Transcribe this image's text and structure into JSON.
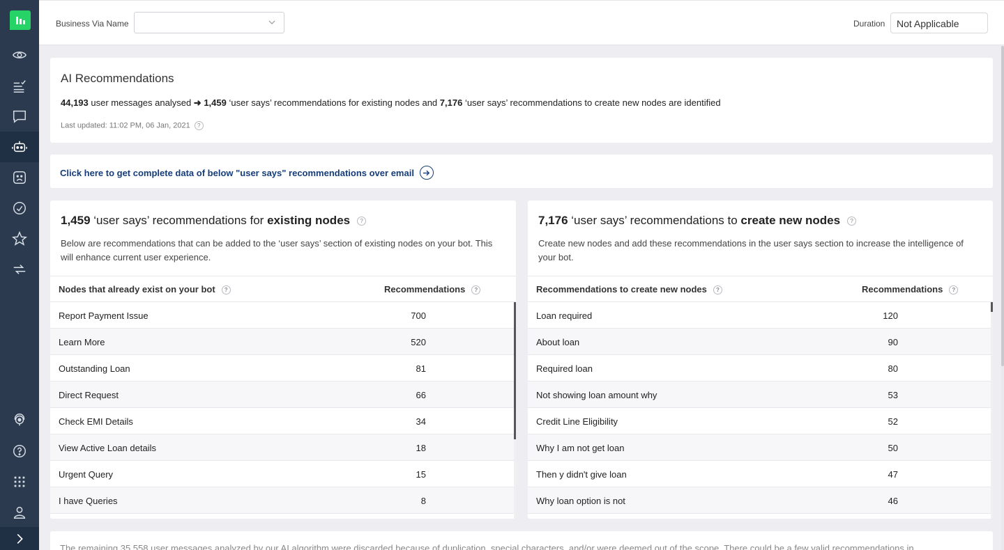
{
  "colors": {
    "sidebar": "#2b3a4e",
    "accent": "#25d366",
    "link": "#163d7a"
  },
  "sidebar": {
    "icons": [
      "app-logo-icon",
      "eye-icon",
      "checklist-icon",
      "chat-icon",
      "bot-icon",
      "sad-face-icon",
      "gauge-icon",
      "star-icon",
      "integration-icon",
      "support-icon",
      "help-icon",
      "apps-grid-icon",
      "user-icon",
      "expand-icon"
    ]
  },
  "topbar": {
    "business_label": "Business Via Name",
    "business_value": "",
    "duration_label": "Duration",
    "duration_value": "Not Applicable"
  },
  "ai": {
    "title": "AI Recommendations",
    "messages_count": "44,193",
    "messages_text": " user messages analysed ",
    "arrow": "➜",
    "existing_count": "1,459",
    "existing_text": " ‘user says’ recommendations for existing nodes and ",
    "new_count": "7,176",
    "new_text": " ‘user says’ recommendations to create new nodes are identified",
    "last_updated": "Last updated: 11:02 PM, 06 Jan, 2021"
  },
  "email": {
    "link_text": "Click here to get complete data of below \"user says\" recommendations over email"
  },
  "existing_panel": {
    "count": "1,459",
    "title_mid": " ‘user says’ recommendations for ",
    "title_bold": "existing nodes",
    "desc": "Below are recommendations that can be added to the ‘user says’ section of existing nodes on your bot. This will enhance current user experience.",
    "col_node": "Nodes that already exist on your bot",
    "col_rec": "Recommendations",
    "rows": [
      {
        "name": "Report Payment Issue",
        "value": "700"
      },
      {
        "name": "Learn More",
        "value": "520"
      },
      {
        "name": "Outstanding Loan",
        "value": "81"
      },
      {
        "name": "Direct Request",
        "value": "66"
      },
      {
        "name": "Check EMI Details",
        "value": "34"
      },
      {
        "name": "View Active Loan details",
        "value": "18"
      },
      {
        "name": "Urgent Query",
        "value": "15"
      },
      {
        "name": "I have Queries",
        "value": "8"
      }
    ]
  },
  "new_panel": {
    "count": "7,176",
    "title_mid": " ‘user says’ recommendations to ",
    "title_bold": "create new nodes",
    "desc": "Create new nodes and add these recommendations in the user says section to increase the intelligence of your bot.",
    "col_node": "Recommendations to create new nodes",
    "col_rec": "Recommendations",
    "rows": [
      {
        "name": "Loan required",
        "value": "120"
      },
      {
        "name": "About loan",
        "value": "90"
      },
      {
        "name": "Required loan",
        "value": "80"
      },
      {
        "name": "Not showing loan amount why",
        "value": "53"
      },
      {
        "name": "Credit Line Eligibility",
        "value": "52"
      },
      {
        "name": "Why I am not get loan",
        "value": "50"
      },
      {
        "name": "Then y didn't give loan",
        "value": "47"
      },
      {
        "name": "Why loan option is not",
        "value": "46"
      }
    ]
  },
  "footer": {
    "note": "The remaining 35,558 user messages analyzed by our AI algorithm were discarded because of duplication, special characters, and/or were deemed out of the scope. There could be a few valid recommendations in"
  },
  "help_mark": "?"
}
